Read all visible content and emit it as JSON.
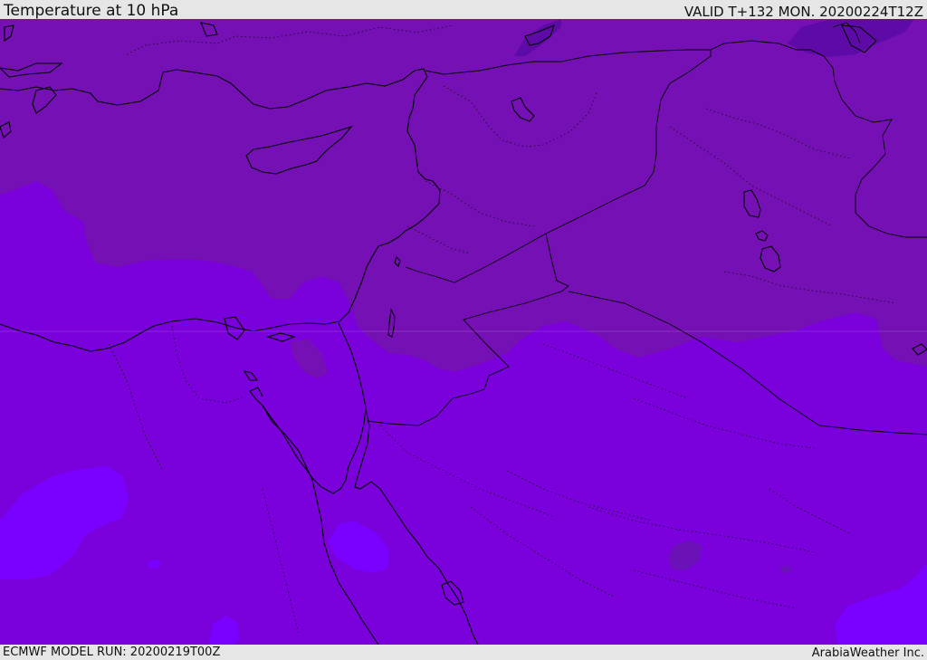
{
  "header": {
    "title": "Temperature at 10 hPa",
    "valid": "VALID T+132 MON. 20200224T12Z"
  },
  "footer": {
    "model_run": "ECMWF MODEL RUN: 20200219T00Z",
    "credit": "ArabiaWeather Inc."
  },
  "map": {
    "field": "temperature",
    "level": "10 hPa",
    "colors": {
      "cold_deep": "#5e0aa6",
      "cold": "#7511b4",
      "base": "#7a00dc",
      "warm": "#7a00ff",
      "coastline": "#000000"
    }
  }
}
